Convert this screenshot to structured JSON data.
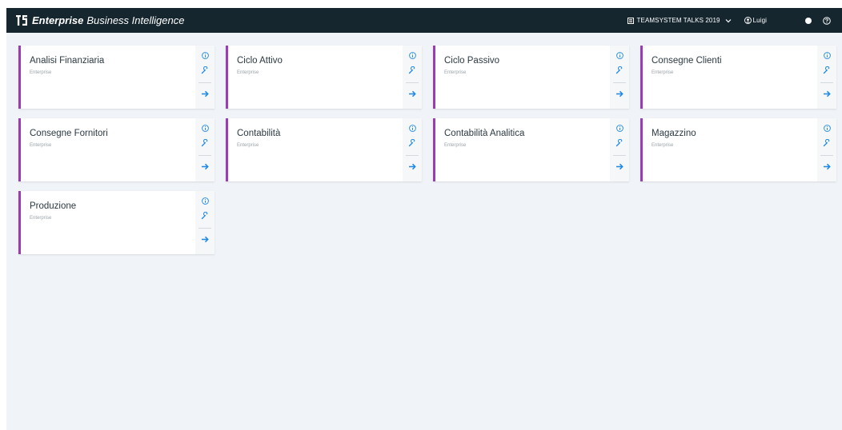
{
  "header": {
    "brand_bold": "Enterprise",
    "brand_rest": "Business Intelligence",
    "company": "TEAMSYSTEM TALKS 2019",
    "user": "Luigi"
  },
  "cards": [
    {
      "title": "Analisi Finanziaria",
      "subtitle": "Enterprise"
    },
    {
      "title": "Ciclo Attivo",
      "subtitle": "Enterprise"
    },
    {
      "title": "Ciclo Passivo",
      "subtitle": "Enterprise"
    },
    {
      "title": "Consegne Clienti",
      "subtitle": "Enterprise"
    },
    {
      "title": "Consegne Fornitori",
      "subtitle": "Enterprise"
    },
    {
      "title": "Contabilità",
      "subtitle": "Enterprise"
    },
    {
      "title": "Contabilità Analitica",
      "subtitle": "Enterprise"
    },
    {
      "title": "Magazzino",
      "subtitle": "Enterprise"
    },
    {
      "title": "Produzione",
      "subtitle": "Enterprise"
    }
  ],
  "colors": {
    "topbar": "#16262f",
    "background": "#f0f3f7",
    "card_accent": "#9c3cb4",
    "action_icon": "#1e88e5"
  },
  "icons": {
    "brand": "ts-logo-icon",
    "company": "building-icon",
    "user": "user-circle-icon",
    "status": "dot-icon",
    "help": "help-circle-icon",
    "info": "info-icon",
    "settings": "wrench-icon",
    "open": "arrow-right-icon"
  }
}
